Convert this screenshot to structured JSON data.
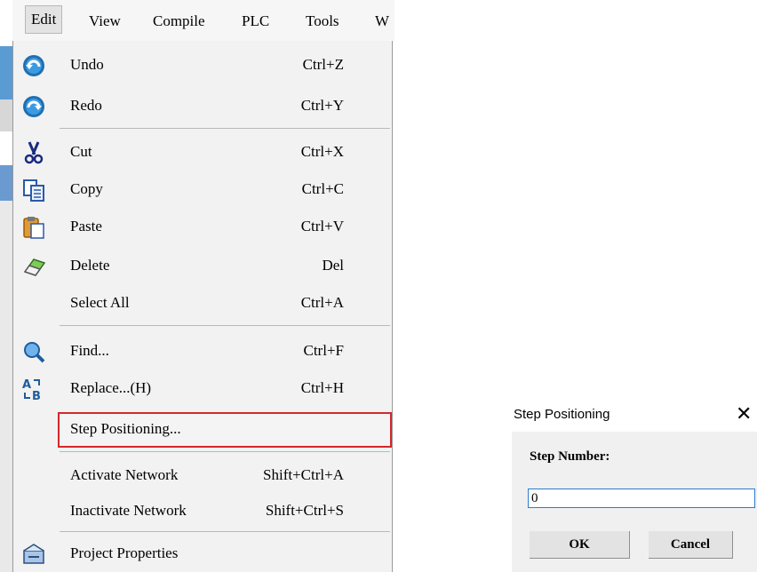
{
  "menubar": {
    "items": [
      "Edit",
      "View",
      "Compile",
      "PLC",
      "Tools",
      "W"
    ]
  },
  "edit_menu": {
    "items": [
      {
        "label": "Undo",
        "shortcut": "Ctrl+Z",
        "icon": "undo-icon"
      },
      {
        "label": "Redo",
        "shortcut": "Ctrl+Y",
        "icon": "redo-icon"
      },
      {
        "label": "Cut",
        "shortcut": "Ctrl+X",
        "icon": "scissors-icon"
      },
      {
        "label": "Copy",
        "shortcut": "Ctrl+C",
        "icon": "copy-icon"
      },
      {
        "label": "Paste",
        "shortcut": "Ctrl+V",
        "icon": "paste-icon"
      },
      {
        "label": "Delete",
        "shortcut": "Del",
        "icon": "eraser-icon"
      },
      {
        "label": "Select All",
        "shortcut": "Ctrl+A"
      },
      {
        "label": "Find...",
        "shortcut": "Ctrl+F",
        "icon": "magnifier-icon"
      },
      {
        "label": "Replace...(H)",
        "shortcut": "Ctrl+H",
        "icon": "replace-icon"
      },
      {
        "label": "Step Positioning...",
        "shortcut": ""
      },
      {
        "label": "Activate Network",
        "shortcut": "Shift+Ctrl+A"
      },
      {
        "label": "Inactivate Network",
        "shortcut": "Shift+Ctrl+S"
      },
      {
        "label": "Project Properties",
        "shortcut": "",
        "icon": "properties-icon"
      }
    ]
  },
  "dialog": {
    "title": "Step Positioning",
    "close_glyph": "✕",
    "field_label": "Step Number:",
    "field_value": "0",
    "ok_label": "OK",
    "cancel_label": "Cancel"
  },
  "colors": {
    "highlight_border": "#d3282b",
    "input_border": "#2b7bd4"
  }
}
